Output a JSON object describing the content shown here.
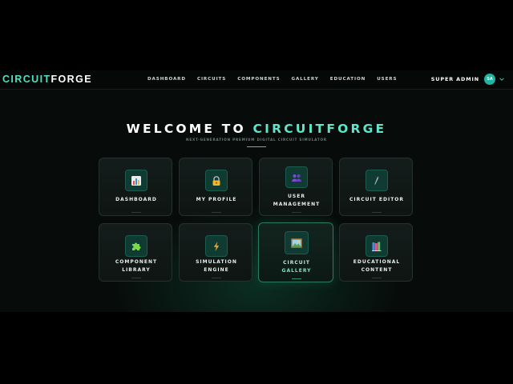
{
  "header": {
    "logo_part1": "CIRCUIT",
    "logo_part2": "FORGE",
    "nav": [
      "DASHBOARD",
      "CIRCUITS",
      "COMPONENTS",
      "GALLERY",
      "EDUCATION",
      "USERS"
    ],
    "user_name": "SUPER ADMIN",
    "avatar_initials": "SA"
  },
  "hero": {
    "title_part1": "WELCOME TO",
    "title_part2": "CIRCUITFORGE",
    "subtitle": "NEXT-GENERATION PREMIUM DIGITAL CIRCUIT SIMULATOR"
  },
  "cards": [
    {
      "label_lines": [
        "DASHBOARD"
      ],
      "icon": "bar-chart-icon"
    },
    {
      "label_lines": [
        "MY PROFILE"
      ],
      "icon": "lock-icon"
    },
    {
      "label_lines": [
        "USER",
        "MANAGEMENT"
      ],
      "icon": "users-icon"
    },
    {
      "label_lines": [
        "CIRCUIT EDITOR"
      ],
      "icon": "pen-icon"
    },
    {
      "label_lines": [
        "COMPONENT",
        "LIBRARY"
      ],
      "icon": "puzzle-icon"
    },
    {
      "label_lines": [
        "SIMULATION",
        "ENGINE"
      ],
      "icon": "lightning-icon"
    },
    {
      "label_lines": [
        "CIRCUIT",
        "GALLERY"
      ],
      "icon": "picture-icon"
    },
    {
      "label_lines": [
        "EDUCATIONAL",
        "CONTENT"
      ],
      "icon": "books-icon"
    }
  ],
  "colors": {
    "accent": "#4fe0c0",
    "background": "#070b0a",
    "card": "#141d1b",
    "active_border": "#2c7a62"
  }
}
